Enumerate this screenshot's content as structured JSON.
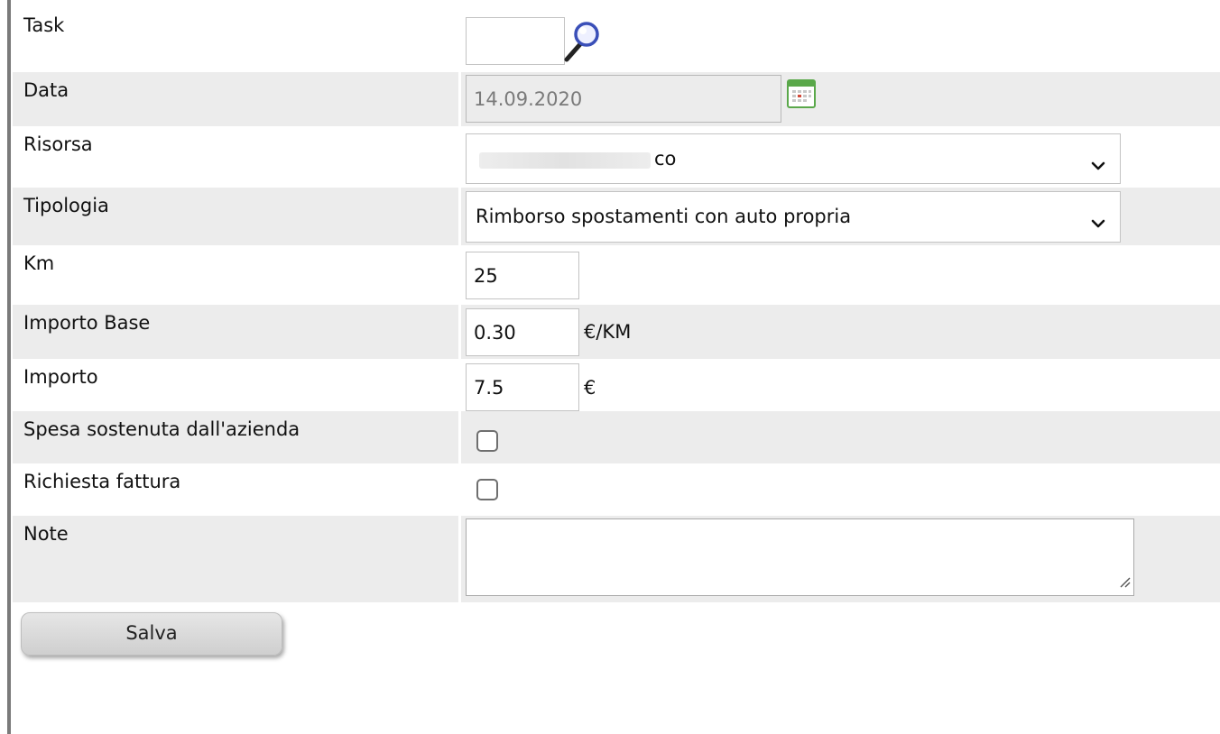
{
  "form": {
    "task": {
      "label": "Task",
      "value": ""
    },
    "data": {
      "label": "Data",
      "value": "14.09.2020"
    },
    "risorsa": {
      "label": "Risorsa",
      "selected_suffix": "co"
    },
    "tipologia": {
      "label": "Tipologia",
      "selected": "Rimborso spostamenti con auto propria"
    },
    "km": {
      "label": "Km",
      "value": "25"
    },
    "importo_base": {
      "label": "Importo Base",
      "value": "0.30",
      "unit": "€/KM"
    },
    "importo": {
      "label": "Importo",
      "value": "7.5",
      "unit": "€"
    },
    "spesa_azienda": {
      "label": "Spesa sostenuta dall'azienda",
      "checked": false
    },
    "richiesta_fattura": {
      "label": "Richiesta fattura",
      "checked": false
    },
    "note": {
      "label": "Note",
      "value": ""
    }
  },
  "actions": {
    "save_label": "Salva"
  },
  "icons": {
    "task_lookup": "search-icon",
    "date_picker": "calendar-icon",
    "dropdown": "chevron-down-icon",
    "resize": "resize-grip-icon"
  },
  "colors": {
    "row_alt_bg": "#ececec",
    "calendar_green": "#5aa84a",
    "lookup_blue": "#3a4fb8"
  }
}
